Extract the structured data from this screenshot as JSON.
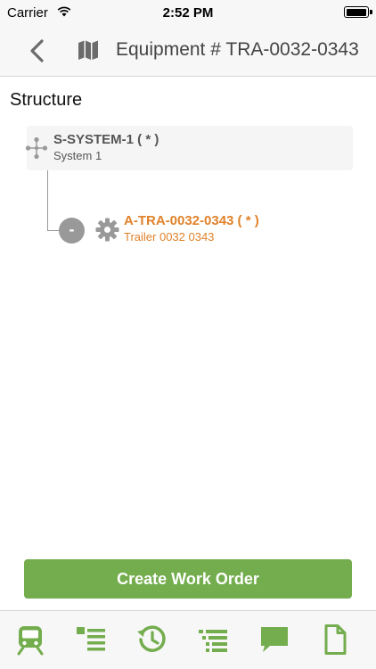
{
  "status_bar": {
    "carrier": "Carrier",
    "time": "2:52 PM",
    "battery_level": 1.0
  },
  "nav": {
    "title": "Equipment # TRA-0032-0343",
    "back_icon": "chevron-left-icon",
    "map_icon": "map-icon"
  },
  "section": {
    "title": "Structure"
  },
  "tree": {
    "root": {
      "title": "S-SYSTEM-1 ( * )",
      "subtitle": "System 1",
      "icon": "hierarchy-icon"
    },
    "children": [
      {
        "title": "A-TRA-0032-0343 ( * )",
        "subtitle": "Trailer 0032 0343",
        "toggle": "-",
        "icon": "gear-icon",
        "color": "#e0822b"
      }
    ]
  },
  "actions": {
    "create_work_order": "Create Work Order"
  },
  "colors": {
    "accent": "#73ad4d",
    "highlight": "#e0822b"
  },
  "tab_bar": {
    "tabs": [
      {
        "icon": "train-icon"
      },
      {
        "icon": "list-icon"
      },
      {
        "icon": "history-icon"
      },
      {
        "icon": "tree-list-icon"
      },
      {
        "icon": "comment-icon"
      },
      {
        "icon": "document-icon"
      }
    ]
  }
}
